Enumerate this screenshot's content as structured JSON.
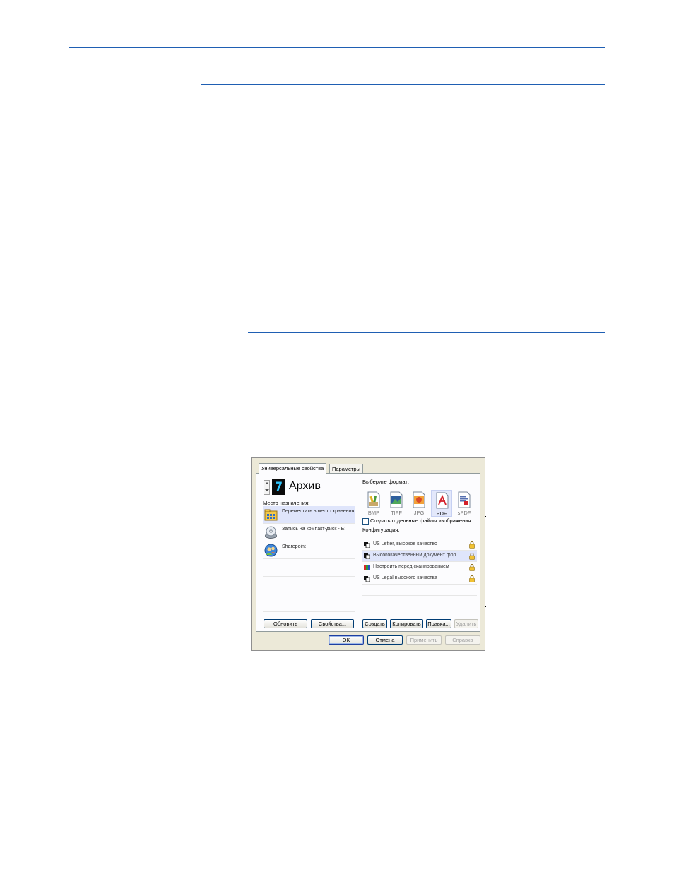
{
  "dialog": {
    "tabs": [
      {
        "label": "Универсальные свойства",
        "active": true
      },
      {
        "label": "Параметры",
        "active": false
      }
    ],
    "header": {
      "title": "Архив",
      "counter_glyph": "7"
    },
    "destination_label": "Место назначения:",
    "destinations": [
      {
        "label": "Переместить в место хранения",
        "icon": "folder-storage-icon",
        "selected": true
      },
      {
        "label": "Запись на компакт-диск - E:",
        "icon": "cd-burn-icon",
        "selected": false
      },
      {
        "label": "Sharepoint",
        "icon": "sharepoint-icon",
        "selected": false
      },
      {
        "label": ""
      },
      {
        "label": ""
      },
      {
        "label": ""
      }
    ],
    "format_label": "Выберите формат:",
    "formats": [
      {
        "label": "BMP",
        "icon": "bmp-icon",
        "selected": false
      },
      {
        "label": "TIFF",
        "icon": "tiff-icon",
        "selected": false
      },
      {
        "label": "JPG",
        "icon": "jpg-icon",
        "selected": false
      },
      {
        "label": "PDF",
        "icon": "pdf-icon",
        "selected": true
      },
      {
        "label": "sPDF",
        "icon": "spdf-icon",
        "selected": false
      }
    ],
    "separate_files_checkbox": {
      "label": "Создать отдельные файлы изображения",
      "checked": false
    },
    "config_label": "Конфигурация:",
    "configs": [
      {
        "label": "US Letter, высокое качество",
        "icon": "bw-config-icon",
        "locked": true,
        "selected": false
      },
      {
        "label": "Высококачественный документ фор...",
        "icon": "bw-config-icon",
        "locked": true,
        "selected": true
      },
      {
        "label": "Настроить перед сканированием",
        "icon": "color-config-icon",
        "locked": true,
        "selected": false
      },
      {
        "label": "US Legal высокого качества",
        "icon": "bw-config-icon",
        "locked": true,
        "selected": false
      },
      {
        "label": ""
      },
      {
        "label": ""
      }
    ],
    "left_buttons": {
      "refresh": "Обновить",
      "properties": "Свойства..."
    },
    "config_buttons": {
      "create": "Создать",
      "copy": "Копировать",
      "edit": "Правка...",
      "delete": "Удалить"
    },
    "footer_buttons": {
      "ok": "OK",
      "cancel": "Отмена",
      "apply": "Применить",
      "help": "Справка"
    }
  },
  "colors": {
    "rule": "#1f5fb3",
    "selection": "#dfe5fb",
    "dialog_bg": "#ece9d8"
  }
}
